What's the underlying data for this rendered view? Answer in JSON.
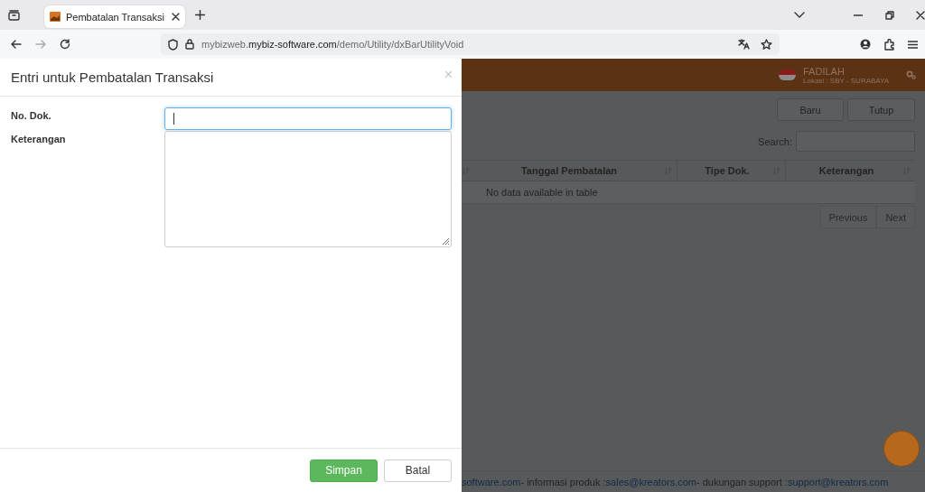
{
  "browser": {
    "tab": {
      "title": "Pembatalan Transaksi",
      "selected": true
    },
    "url": "mybizweb.**mybiz-software.com**/demo/Utility/dxBarUtilityVoid"
  },
  "app": {
    "user": {
      "name": "FADILAH",
      "location": "Lokasi : SBY - SURABAYA"
    },
    "toolbar_buttons": [
      "Baru",
      "Tutup"
    ],
    "search": {
      "label": "Search:"
    },
    "table": {
      "columns": [
        "Tanggal Pembatalan",
        "Tipe Dok.",
        "Keterangan"
      ],
      "empty_message": "No data available in table"
    },
    "pagination": [
      {
        "label": "Previous",
        "disabled": true
      },
      {
        "label": "Next",
        "disabled": true
      }
    ],
    "footer": [
      {
        "kind": "link",
        "text": "software.com"
      },
      {
        "kind": "text",
        "text": " - informasi produk : "
      },
      {
        "kind": "link",
        "text": "sales@kreators.com"
      },
      {
        "kind": "text",
        "text": " - dukungan support : "
      },
      {
        "kind": "link",
        "text": "support@kreators.com"
      }
    ]
  },
  "modal": {
    "title": "Entri untuk Pembatalan Transaksi",
    "close": "×",
    "fields": [
      {
        "label": "No. Dok.",
        "kind": "input",
        "focused": true
      },
      {
        "label": "Keterangan",
        "kind": "textarea",
        "focused": false
      }
    ],
    "buttons": [
      {
        "label": "Simpan",
        "kind": "primary"
      },
      {
        "label": "Batal",
        "kind": "default"
      }
    ]
  }
}
